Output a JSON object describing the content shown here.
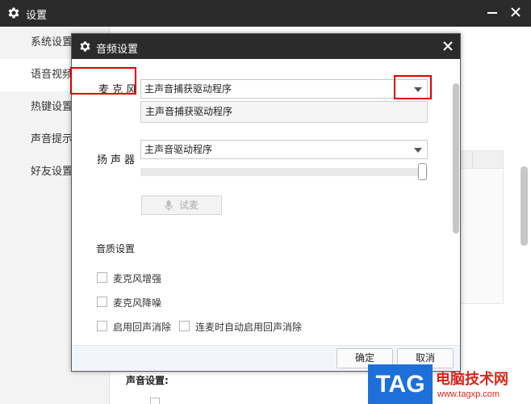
{
  "window": {
    "title": "设置"
  },
  "sidebar": {
    "items": [
      {
        "label": "系统设置"
      },
      {
        "label": "语音视频"
      },
      {
        "label": "热键设置"
      },
      {
        "label": "声音提示"
      },
      {
        "label": "好友设置"
      }
    ]
  },
  "background": {
    "sound_settings_label": "声音设置:"
  },
  "dialog": {
    "title": "音频设置",
    "microphone": {
      "label": "麦克风",
      "selected": "主声音捕获驱动程序",
      "options": [
        "主声音捕获驱动程序"
      ]
    },
    "speaker": {
      "label": "扬声器",
      "selected": "主声音驱动程序",
      "volume_level": 1.0
    },
    "test_button_label": "试麦",
    "quality": {
      "title": "音质设置",
      "options": [
        {
          "label": "麦克风增强",
          "checked": false
        },
        {
          "label": "麦克风降噪",
          "checked": false
        },
        {
          "label": "启用回声消除",
          "checked": false
        },
        {
          "label": "连麦时自动启用回声消除",
          "checked": false
        }
      ]
    },
    "confirm_label": "确定",
    "cancel_label": "取消"
  },
  "watermark": {
    "tag": "TAG",
    "site_name": "电脑技术网",
    "url": "www.tagxp.com"
  },
  "colors": {
    "titlebar": "#2b2b2b",
    "highlight_box": "#e00000",
    "footer_bg": "#f2f6fb",
    "watermark_blue": "#1e6fd9",
    "watermark_red": "#d8261b"
  },
  "icons": [
    "gear-icon",
    "minimize-icon",
    "close-icon",
    "chevron-down-icon",
    "microphone-icon"
  ]
}
